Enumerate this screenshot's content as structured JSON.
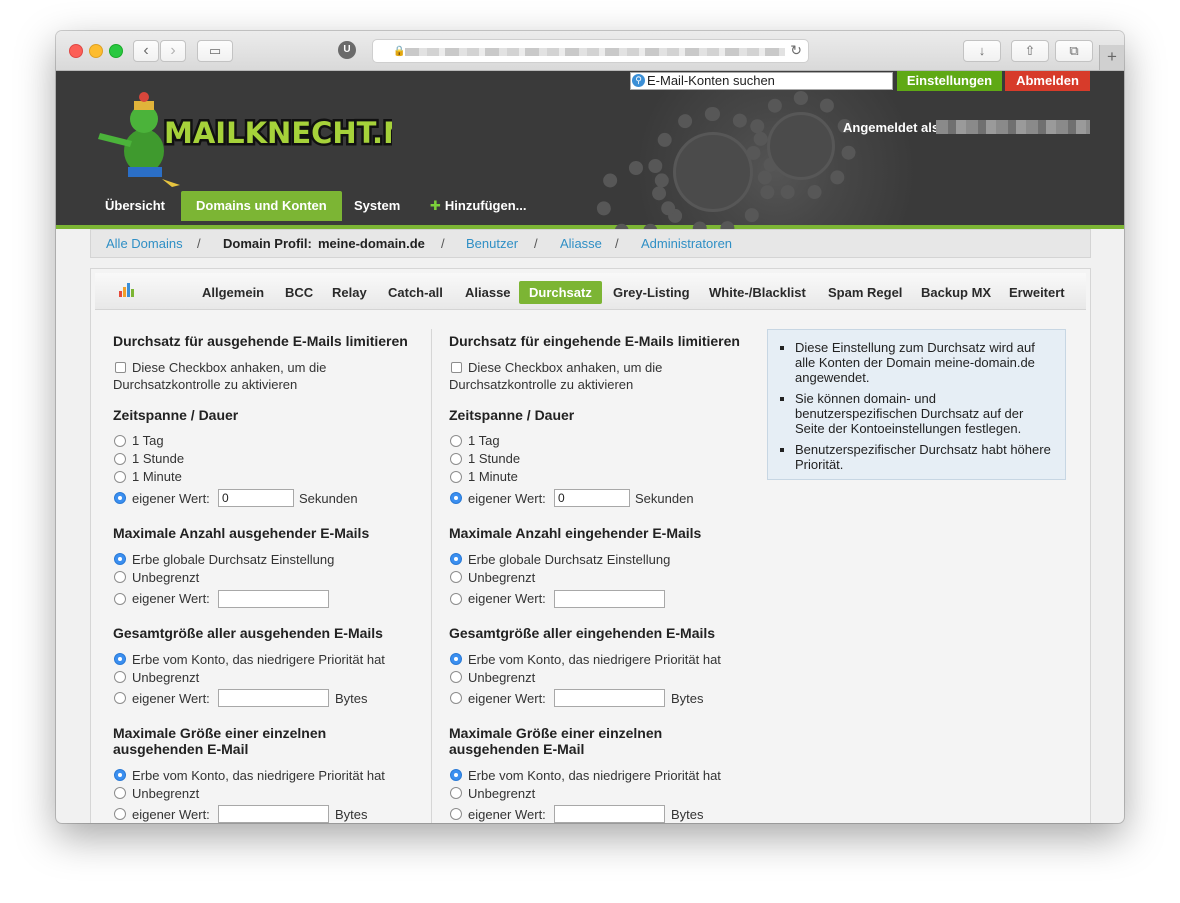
{
  "browser": {
    "reader_label": "U",
    "back_glyph": "‹",
    "forward_glyph": "›",
    "sidebar_glyph": "▭",
    "reload_glyph": "↻",
    "download_glyph": "↓",
    "share_glyph": "⇧",
    "tabs_glyph": "⧉",
    "new_tab_glyph": "+"
  },
  "header": {
    "search_placeholder": "E-Mail-Konten suchen",
    "settings_label": "Einstellungen",
    "logout_label": "Abmelden",
    "logged_in_label": "Angemeldet als",
    "logo_text": "MAILKNECHT.NET",
    "nav": [
      "Übersicht",
      "Domains und Konten",
      "System",
      "Hinzufügen..."
    ],
    "nav_plus": "✚",
    "accent_color": "#7cb534",
    "logout_color": "#d73b2a"
  },
  "breadcrumb": {
    "all_domains": "Alle Domains",
    "sep": "/",
    "profile_label": "Domain Profil:",
    "profile_domain": "meine-domain.de",
    "users": "Benutzer",
    "aliases": "Aliasse",
    "admins": "Administratoren"
  },
  "tabs": [
    "Allgemein",
    "BCC",
    "Relay",
    "Catch-all",
    "Aliasse",
    "Durchsatz",
    "Grey-Listing",
    "White-/Blacklist",
    "Spam Regel",
    "Backup MX",
    "Erweitert"
  ],
  "outgoing": {
    "title": "Durchsatz für ausgehende E-Mails limitieren",
    "checkbox_label_1": "Diese Checkbox anhaken, um die",
    "checkbox_label_2": "Durchsatzkontrolle zu aktivieren",
    "period_title": "Zeitspanne / Dauer",
    "period_options": [
      "1 Tag",
      "1 Stunde",
      "1 Minute",
      "eigener Wert:"
    ],
    "period_value": "0",
    "period_unit": "Sekunden",
    "max_title": "Maximale Anzahl ausgehender E-Mails",
    "max_options": [
      "Erbe globale Durchsatz Einstellung",
      "Unbegrenzt",
      "eigener Wert:"
    ],
    "total_title": "Gesamtgröße aller ausgehenden E-Mails",
    "total_options": [
      "Erbe vom Konto, das niedrigere Priorität hat",
      "Unbegrenzt",
      "eigener Wert:"
    ],
    "total_unit": "Bytes",
    "single_title_1": "Maximale Größe einer einzelnen",
    "single_title_2": "ausgehenden E-Mail",
    "single_options": [
      "Erbe vom Konto, das niedrigere Priorität hat",
      "Unbegrenzt",
      "eigener Wert:"
    ],
    "single_unit": "Bytes"
  },
  "incoming": {
    "title": "Durchsatz für eingehende E-Mails limitieren",
    "checkbox_label_1": "Diese Checkbox anhaken, um die",
    "checkbox_label_2": "Durchsatzkontrolle zu aktivieren",
    "period_title": "Zeitspanne / Dauer",
    "period_options": [
      "1 Tag",
      "1 Stunde",
      "1 Minute",
      "eigener Wert:"
    ],
    "period_value": "0",
    "period_unit": "Sekunden",
    "max_title": "Maximale Anzahl eingehender E-Mails",
    "max_options": [
      "Erbe globale Durchsatz Einstellung",
      "Unbegrenzt",
      "eigener Wert:"
    ],
    "total_title": "Gesamtgröße aller eingehenden E-Mails",
    "total_options": [
      "Erbe vom Konto, das niedrigere Priorität hat",
      "Unbegrenzt",
      "eigener Wert:"
    ],
    "total_unit": "Bytes",
    "single_title_1": "Maximale Größe einer einzelnen",
    "single_title_2": "ausgehenden E-Mail",
    "single_options": [
      "Erbe vom Konto, das niedrigere Priorität hat",
      "Unbegrenzt",
      "eigener Wert:"
    ],
    "single_unit": "Bytes"
  },
  "info": [
    [
      "Diese Einstellung zum Durchsatz wird auf",
      "alle Konten der Domain meine-domain.de",
      "angewendet."
    ],
    [
      "Sie können domain- und",
      "benutzerspezifischen Durchsatz auf der",
      "Seite der Kontoeinstellungen festlegen."
    ],
    [
      "Benutzerspezifischer Durchsatz habt höhere",
      "Priorität."
    ]
  ]
}
